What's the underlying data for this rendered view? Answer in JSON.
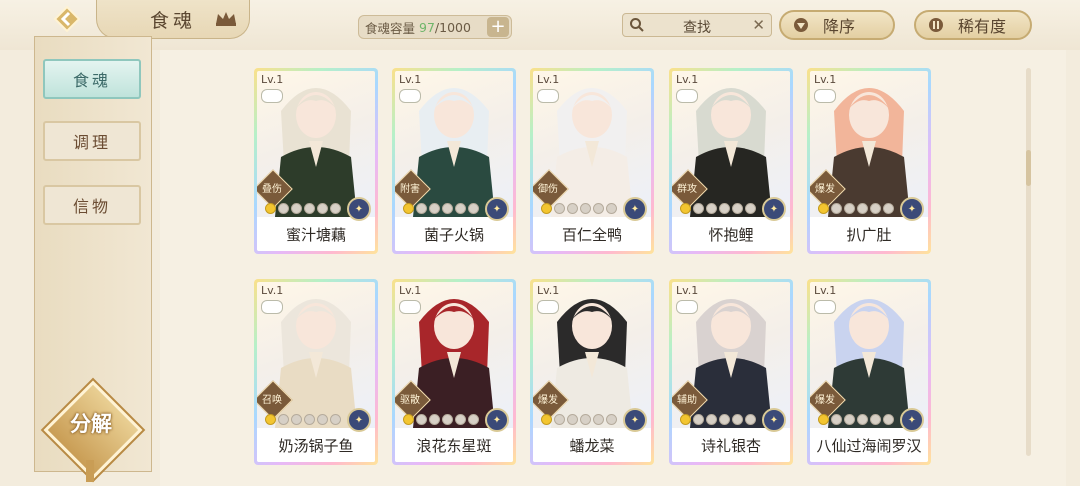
{
  "header": {
    "title": "食魂",
    "capacity_label": "食魂容量",
    "capacity_current": "97",
    "capacity_max": "/1000",
    "search_placeholder": "查找",
    "sort_order": "降序",
    "sort_key": "稀有度"
  },
  "sidebar": {
    "items": [
      {
        "label": "食魂"
      },
      {
        "label": "调理"
      },
      {
        "label": "信物"
      }
    ],
    "decompose_label": "分解"
  },
  "cards": [
    {
      "level": "Lv.1",
      "role": "叠伤",
      "name": "蜜汁塘藕",
      "stars_lit": 1,
      "hair": "#e9e2d3",
      "robe": "#2d3c2a"
    },
    {
      "level": "Lv.1",
      "role": "附害",
      "name": "菌子火锅",
      "stars_lit": 1,
      "hair": "#e8eef2",
      "robe": "#2a4a40"
    },
    {
      "level": "Lv.1",
      "role": "御伤",
      "name": "百仁全鸭",
      "stars_lit": 1,
      "hair": "#f1f0f0",
      "robe": "#f4ede6"
    },
    {
      "level": "Lv.1",
      "role": "群攻",
      "name": "怀抱鲤",
      "stars_lit": 1,
      "hair": "#d8dad0",
      "robe": "#262622"
    },
    {
      "level": "Lv.1",
      "role": "爆发",
      "name": "扒广肚",
      "stars_lit": 1,
      "hair": "#f2b59a",
      "robe": "#4a3a30"
    },
    {
      "level": "Lv.1",
      "role": "召唤",
      "name": "奶汤锅子鱼",
      "stars_lit": 1,
      "hair": "#ece6dc",
      "robe": "#e9dcc4"
    },
    {
      "level": "Lv.1",
      "role": "驱散",
      "name": "浪花东星斑",
      "stars_lit": 1,
      "hair": "#a8262a",
      "robe": "#3b1f24"
    },
    {
      "level": "Lv.1",
      "role": "爆发",
      "name": "蟠龙菜",
      "stars_lit": 1,
      "hair": "#2b2a2a",
      "robe": "#eeeae2"
    },
    {
      "level": "Lv.1",
      "role": "辅助",
      "name": "诗礼银杏",
      "stars_lit": 1,
      "hair": "#d9d2d0",
      "robe": "#2a2e3a"
    },
    {
      "level": "Lv.1",
      "role": "爆发",
      "name": "八仙过海闹罗汉",
      "stars_lit": 1,
      "hair": "#c9d3ef",
      "robe": "#2e3a36"
    }
  ],
  "colors": {
    "accent": "#c6ab72",
    "active_tab": "#bfe3db",
    "star_lit": "#f3c530",
    "capacity_current": "#6fb56a"
  },
  "icons": [
    "back-arrow-icon",
    "crown-icon",
    "plus-icon",
    "search-icon",
    "clear-icon",
    "sort-down-icon",
    "sort-rarity-icon"
  ]
}
